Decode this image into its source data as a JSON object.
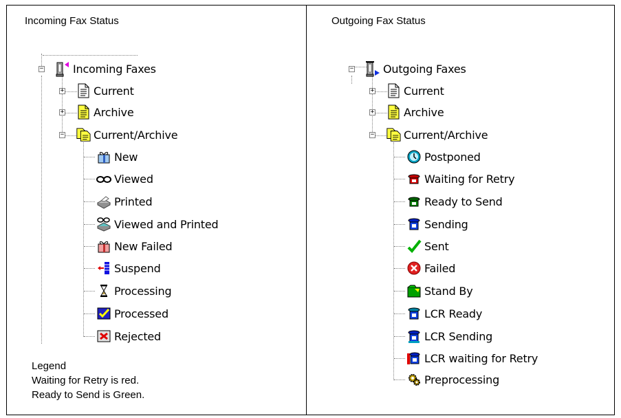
{
  "incoming": {
    "title": "Incoming Fax Status",
    "root": "Incoming Faxes",
    "folders": [
      "Current",
      "Archive",
      "Current/Archive"
    ],
    "statuses": [
      "New",
      "Viewed",
      "Printed",
      "Viewed and Printed",
      "New Failed",
      "Suspend",
      "Processing",
      "Processed",
      "Rejected"
    ]
  },
  "outgoing": {
    "title": "Outgoing Fax Status",
    "root": "Outgoing Faxes",
    "folders": [
      "Current",
      "Archive",
      "Current/Archive"
    ],
    "statuses": [
      "Postponed",
      "Waiting for Retry",
      "Ready to Send",
      "Sending",
      "Sent",
      "Failed",
      "Stand By",
      "LCR Ready",
      "LCR Sending",
      "LCR waiting for Retry",
      "Preprocessing"
    ]
  },
  "legend": {
    "title": "Legend",
    "lines": [
      "Waiting for Retry is red.",
      "Ready to Send is Green."
    ]
  }
}
